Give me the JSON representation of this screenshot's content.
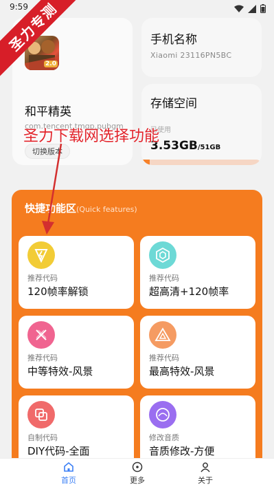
{
  "status_bar": {
    "time": "9:59"
  },
  "watermark": {
    "text": "圣力专测"
  },
  "app_card": {
    "name": "和平精英",
    "package": "com.tencent.tmgp.pubgm",
    "switch_label": "切换版本",
    "icon_badge": "2.0"
  },
  "phone_card": {
    "title": "手机名称",
    "value": "Xiaomi 23116PN5BC"
  },
  "storage_card": {
    "title": "存储空间",
    "caption": "已使用",
    "used": "3.53GB",
    "total": "/51GB",
    "used_fraction": 0.07
  },
  "annotation": {
    "text": "圣力下载网选择功能"
  },
  "quick_features": {
    "title": "快捷功能区",
    "subtitle": "(Quick features)",
    "items": [
      {
        "label": "推荐代码",
        "name": "120帧率解锁",
        "icon": "lightning-icon",
        "color": "#f2cc36"
      },
      {
        "label": "推荐代码",
        "name": "超高清+120帧率",
        "icon": "hexagon-icon",
        "color": "#6dd9d6"
      },
      {
        "label": "推荐代码",
        "name": "中等特效-风景",
        "icon": "cross-icon",
        "color": "#f06490"
      },
      {
        "label": "推荐代码",
        "name": "最高特效-风景",
        "icon": "triangle-icon",
        "color": "#f59b62"
      },
      {
        "label": "自制代码",
        "name": "DIY代码-全面",
        "icon": "layers-icon",
        "color": "#f06a6a"
      },
      {
        "label": "修改音质",
        "name": "音质修改-方便",
        "icon": "sound-icon",
        "color": "#9a6ef0"
      }
    ]
  },
  "bottom_nav": {
    "items": [
      {
        "label": "首页",
        "active": true
      },
      {
        "label": "更多",
        "active": false
      },
      {
        "label": "关于",
        "active": false
      }
    ],
    "active_color": "#3b7ff5"
  }
}
